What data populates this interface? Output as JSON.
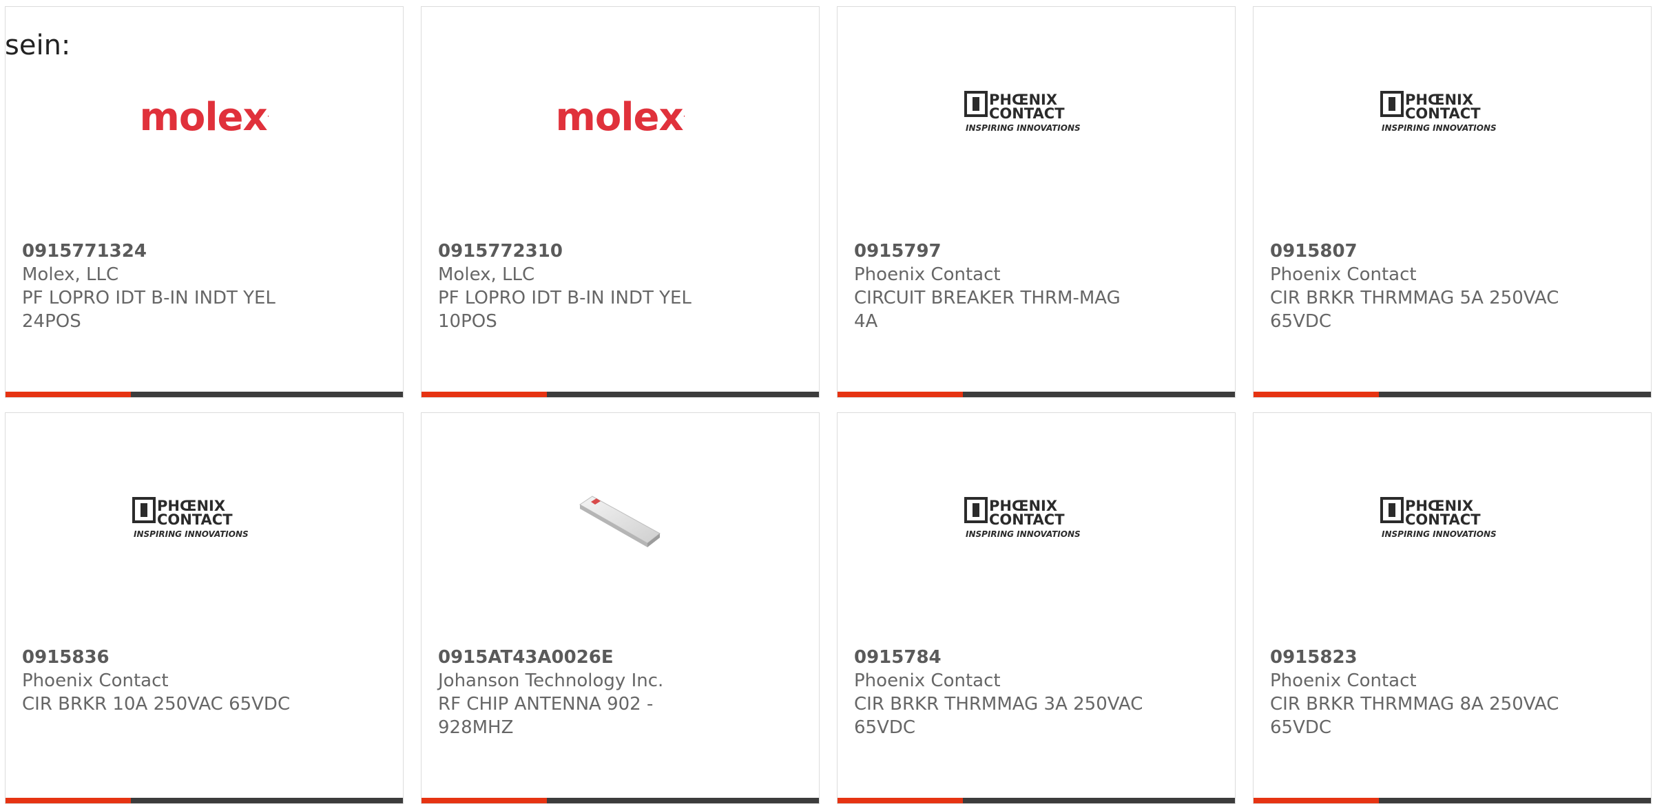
{
  "lead_text": "sein:",
  "colors": {
    "accent": "#e63312",
    "bar_dark": "#3c3c3c",
    "molex_red": "#e0313b",
    "phoenix_dark": "#2b2b2b"
  },
  "products": [
    {
      "part_number": "0915771324",
      "manufacturer": "Molex, LLC",
      "description": "PF LOPRO IDT B-IN INDT YEL 24POS",
      "image": "molex-logo"
    },
    {
      "part_number": "0915772310",
      "manufacturer": "Molex, LLC",
      "description": "PF LOPRO IDT B-IN INDT YEL 10POS",
      "image": "molex-logo"
    },
    {
      "part_number": "0915797",
      "manufacturer": "Phoenix Contact",
      "description": "CIRCUIT BREAKER THRM-MAG 4A",
      "image": "phoenix-contact-logo"
    },
    {
      "part_number": "0915807",
      "manufacturer": "Phoenix Contact",
      "description": "CIR BRKR THRMMAG 5A 250VAC 65VDC",
      "image": "phoenix-contact-logo"
    },
    {
      "part_number": "0915836",
      "manufacturer": "Phoenix Contact",
      "description": "CIR BRKR 10A 250VAC 65VDC",
      "image": "phoenix-contact-logo"
    },
    {
      "part_number": "0915AT43A0026E",
      "manufacturer": "Johanson Technology Inc.",
      "description": "RF CHIP ANTENNA 902 - 928MHZ",
      "image": "chip-antenna-photo"
    },
    {
      "part_number": "0915784",
      "manufacturer": "Phoenix Contact",
      "description": "CIR BRKR THRMMAG 3A 250VAC 65VDC",
      "image": "phoenix-contact-logo"
    },
    {
      "part_number": "0915823",
      "manufacturer": "Phoenix Contact",
      "description": "CIR BRKR THRMMAG 8A 250VAC 65VDC",
      "image": "phoenix-contact-logo"
    }
  ],
  "logos": {
    "molex": "molex",
    "phoenix_line1": "PHŒNIX",
    "phoenix_line2": "CONTACT",
    "phoenix_tagline": "INSPIRING INNOVATIONS"
  }
}
